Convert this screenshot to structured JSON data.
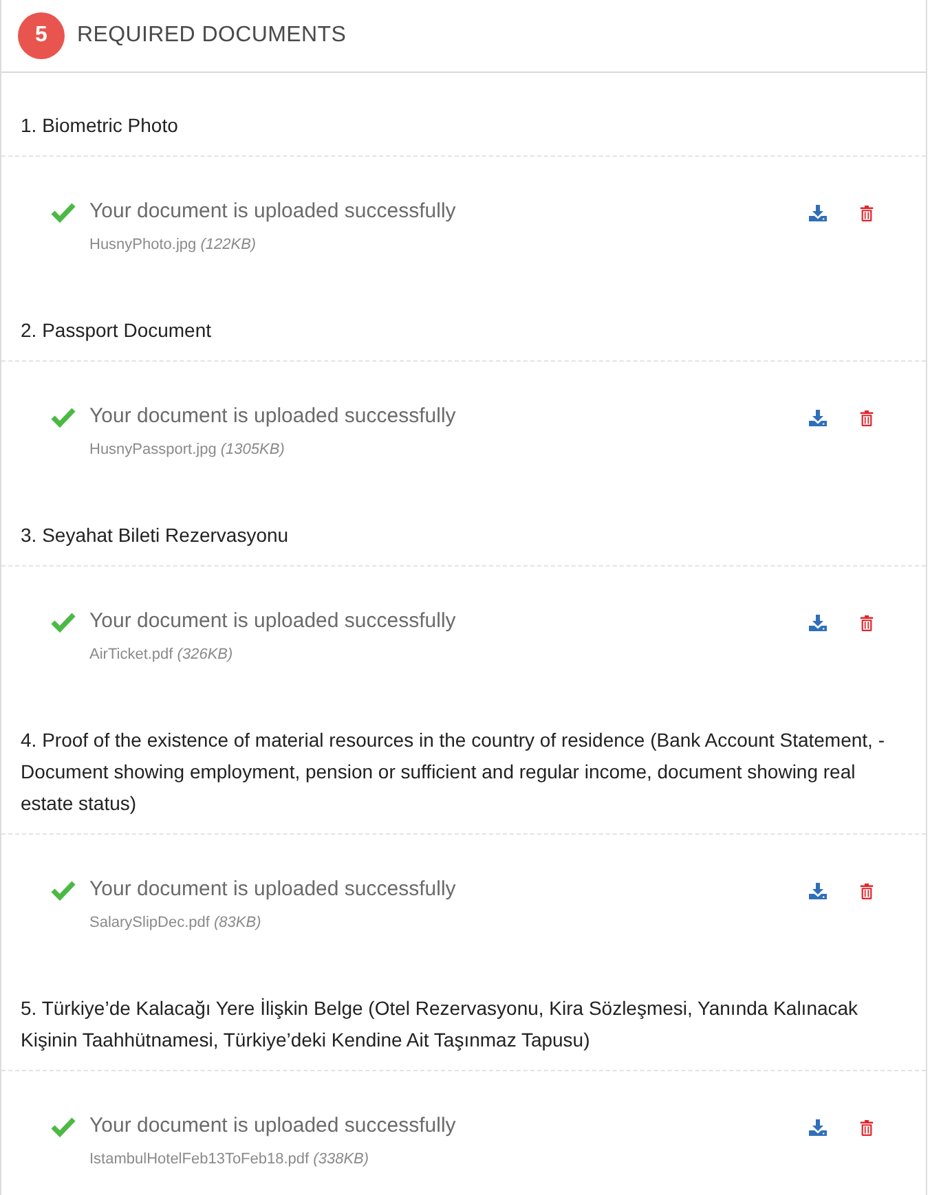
{
  "header": {
    "step": "5",
    "title": "REQUIRED DOCUMENTS"
  },
  "documents": [
    {
      "title": "1. Biometric Photo",
      "status": "Your document is uploaded successfully",
      "file_name": "HusnyPhoto.jpg",
      "file_size": "(122KB)"
    },
    {
      "title": "2. Passport Document",
      "status": "Your document is uploaded successfully",
      "file_name": "HusnyPassport.jpg",
      "file_size": "(1305KB)"
    },
    {
      "title": "3. Seyahat Bileti Rezervasyonu",
      "status": "Your document is uploaded successfully",
      "file_name": "AirTicket.pdf",
      "file_size": "(326KB)"
    },
    {
      "title": "4. Proof of the existence of material resources in the country of residence (Bank Account Statement, -Document showing employment, pension or sufficient and regular income, document showing real estate status)",
      "status": "Your document is uploaded successfully",
      "file_name": "SalarySlipDec.pdf",
      "file_size": "(83KB)"
    },
    {
      "title": "5. Türkiye’de Kalacağı Yere İlişkin Belge (Otel Rezervasyonu, Kira Sözleşmesi, Yanında Kalınacak Kişinin Taahhütnamesi, Türkiye’deki Kendine Ait Taşınmaz Tapusu)",
      "status": "Your document is uploaded successfully",
      "file_name": "IstambulHotelFeb13ToFeb18.pdf",
      "file_size": "(338KB)"
    }
  ]
}
